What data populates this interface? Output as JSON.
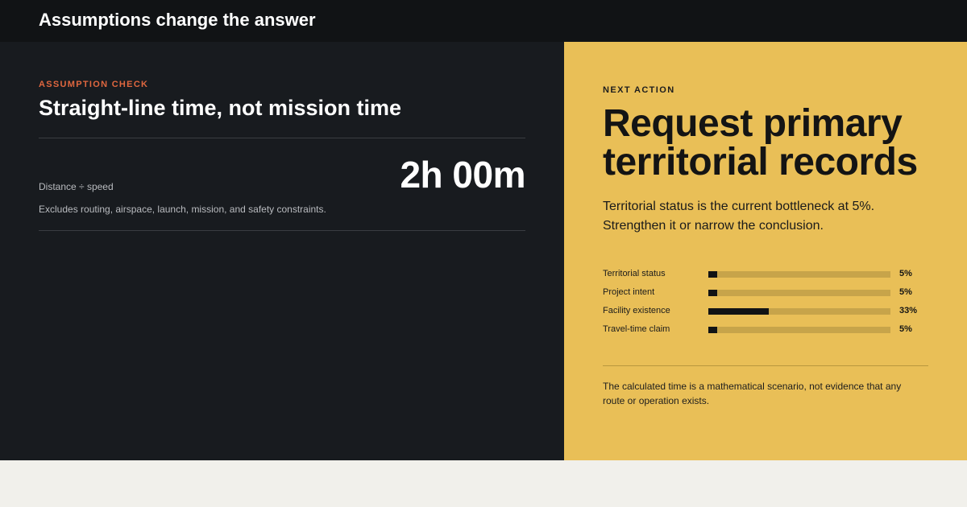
{
  "header": {
    "title": "Assumptions change the answer"
  },
  "assumption": {
    "eyebrow": "ASSUMPTION CHECK",
    "title": "Straight-line time, not mission time",
    "formula": "Distance ÷ speed",
    "excludes": "Excludes routing, airspace, launch, mission, and safety constraints.",
    "time_value": "2h 00m"
  },
  "next_action": {
    "eyebrow": "NEXT ACTION",
    "title": "Request primary territorial records",
    "description": "Territorial status is the current bottleneck at 5%. Strengthen it or narrow the conclusion.",
    "footnote": "The calculated time is a mathematical scenario, not evidence that any route or operation exists."
  },
  "chart_data": {
    "type": "bar",
    "categories": [
      "Territorial status",
      "Project intent",
      "Facility existence",
      "Travel-time claim"
    ],
    "values": [
      5,
      5,
      33,
      5
    ],
    "value_labels": [
      "5%",
      "5%",
      "33%",
      "5%"
    ],
    "ylim": [
      0,
      100
    ]
  },
  "colors": {
    "accent_eyebrow": "#e0673f",
    "panel_dark": "#181b1f",
    "panel_yellow": "#e9bf57",
    "bar_fill": "#111315",
    "bar_track": "#c7a44a"
  }
}
